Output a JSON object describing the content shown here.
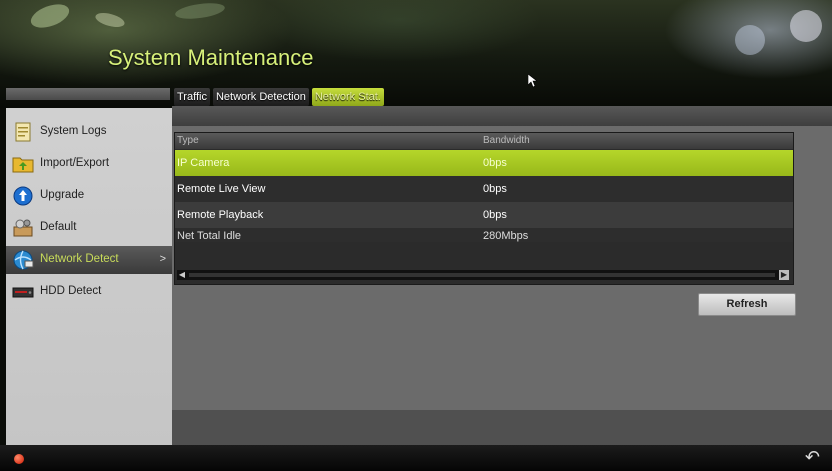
{
  "header": {
    "title": "System Maintenance"
  },
  "tabs": [
    {
      "label": "Traffic"
    },
    {
      "label": "Network Detection"
    },
    {
      "label": "Network Stat."
    }
  ],
  "sidebar": {
    "items": [
      {
        "label": "System Logs",
        "icon": "log-icon"
      },
      {
        "label": "Import/Export",
        "icon": "folder-icon"
      },
      {
        "label": "Upgrade",
        "icon": "upgrade-icon"
      },
      {
        "label": "Default",
        "icon": "default-icon"
      },
      {
        "label": "Network Detect",
        "icon": "network-icon",
        "arrow": ">"
      },
      {
        "label": "HDD Detect",
        "icon": "hdd-icon"
      }
    ]
  },
  "table": {
    "columns": [
      "Type",
      "Bandwidth"
    ],
    "rows": [
      {
        "type": "IP Camera",
        "bandwidth": "0bps"
      },
      {
        "type": "Remote Live View",
        "bandwidth": "0bps"
      },
      {
        "type": "Remote Playback",
        "bandwidth": "0bps"
      },
      {
        "type": "Net Total Idle",
        "bandwidth": "280Mbps"
      }
    ]
  },
  "buttons": {
    "refresh": "Refresh"
  },
  "colors": {
    "accent": "#b5d62a",
    "title": "#d7f07a"
  }
}
